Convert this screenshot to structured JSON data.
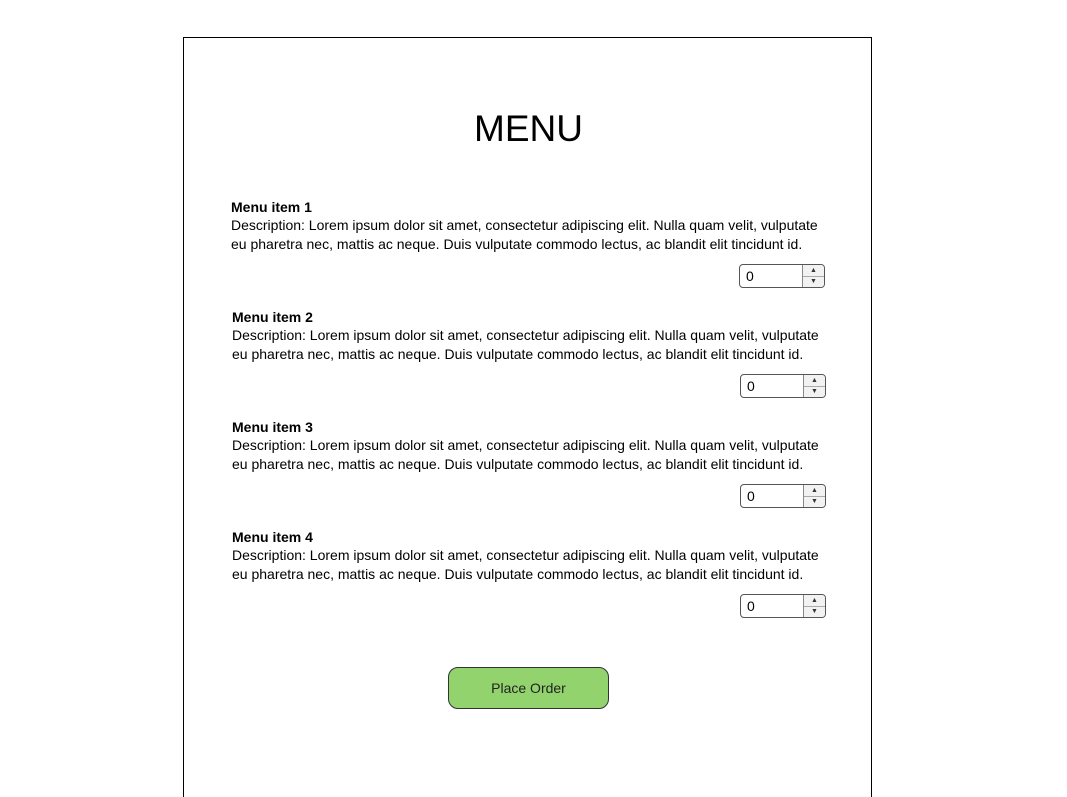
{
  "page": {
    "title": "MENU"
  },
  "menu_items": [
    {
      "name": "Menu item 1",
      "description": "Description: Lorem ipsum dolor sit amet, consectetur adipiscing elit. Nulla quam velit, vulputate eu pharetra nec, mattis ac neque. Duis vulputate commodo lectus, ac blandit elit tincidunt id.",
      "quantity": "0"
    },
    {
      "name": "Menu item 2",
      "description": "Description: Lorem ipsum dolor sit amet, consectetur adipiscing elit. Nulla quam velit, vulputate eu pharetra nec, mattis ac neque. Duis vulputate commodo lectus, ac blandit elit tincidunt id.",
      "quantity": "0"
    },
    {
      "name": "Menu item 3",
      "description": "Description: Lorem ipsum dolor sit amet, consectetur adipiscing elit. Nulla quam velit, vulputate eu pharetra nec, mattis ac neque. Duis vulputate commodo lectus, ac blandit elit tincidunt id.",
      "quantity": "0"
    },
    {
      "name": "Menu item 4",
      "description": "Description: Lorem ipsum dolor sit amet, consectetur adipiscing elit. Nulla quam velit, vulputate eu pharetra nec, mattis ac neque. Duis vulputate commodo lectus, ac blandit elit tincidunt id.",
      "quantity": "0"
    }
  ],
  "stepper_icons": {
    "up": "▲",
    "down": "▼"
  },
  "order": {
    "label": "Place Order"
  },
  "colors": {
    "order_button": "#92d36e",
    "border": "#000000"
  }
}
